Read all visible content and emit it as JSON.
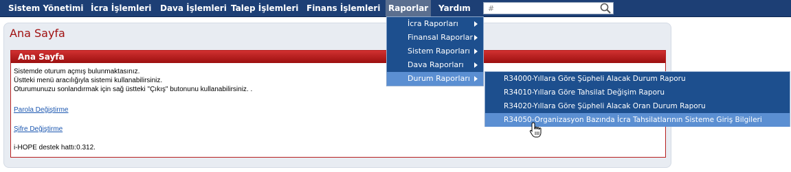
{
  "nav": {
    "items": [
      "Sistem Yönetimi",
      "İcra İşlemleri",
      "Dava İşlemleri",
      "Talep İşlemleri",
      "Finans İşlemleri",
      "Raporlar",
      "Yardım"
    ],
    "active_item": "Raporlar",
    "search_value": "#"
  },
  "page": {
    "title": "Ana Sayfa"
  },
  "panel": {
    "header": "Ana Sayfa",
    "lines": [
      "Sistemde oturum açmış bulunmaktasınız.",
      "Üstteki menü aracılığıyla sistemi kullanabilirsiniz.",
      "Oturumunuzu sonlandırmak için sağ üstteki \"Çıkış\" butonunu kullanabilirsiniz. ."
    ],
    "links": {
      "password_change": "Parola Değiştirme",
      "cipher_change": "Şifre Değiştirme"
    },
    "support_line": "i-HOPE destek hattı:0.312."
  },
  "reports_menu": {
    "items": [
      "İcra Raporları",
      "Finansal Raporlar",
      "Sistem Raporları",
      "Dava Raporları",
      "Durum Raporları"
    ],
    "highlighted": "Durum Raporları"
  },
  "status_reports_submenu": {
    "items": [
      "R34000-Yıllara Göre Şüpheli Alacak Durum Raporu",
      "R34010-Yıllara Göre Tahsilat Değişim Raporu",
      "R34020-Yıllara Göre Şüpheli Alacak Oran Durum Raporu",
      "R34050-Organizasyon Bazında İcra Tahsilatlarının Sisteme Giriş Bilgileri"
    ],
    "highlighted": "R34050-Organizasyon Bazında İcra Tahsilatlarının Sisteme Giriş Bilgileri"
  },
  "colors": {
    "nav_bg": "#1d3f75",
    "menu_bg": "#1d4f8e",
    "menu_highlight": "#5b8fd2",
    "panel_header": "#b71c1c",
    "title_red": "#a01010",
    "link_blue": "#1a56b0"
  },
  "icons": {
    "search": "search-icon",
    "submenu_arrow": "chevron-right-icon",
    "cursor": "hand-pointer-icon"
  }
}
